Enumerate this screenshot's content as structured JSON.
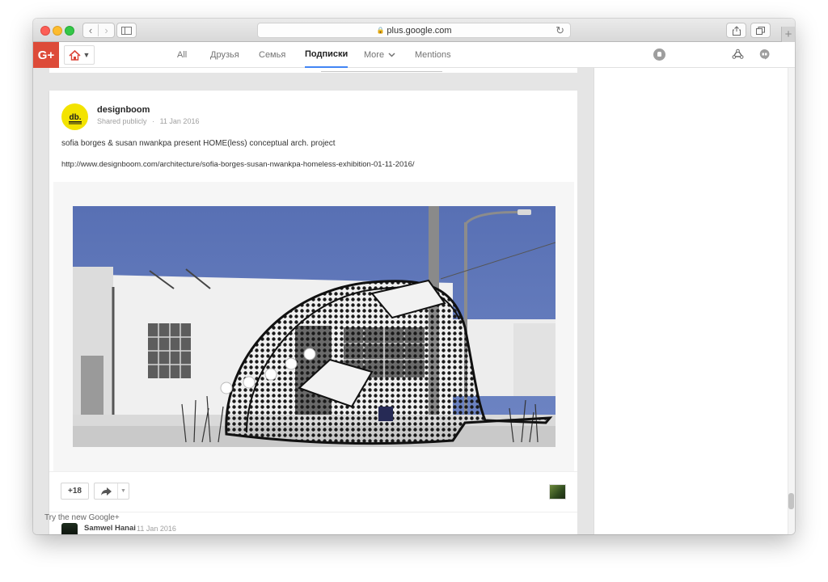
{
  "browser": {
    "url": "plus.google.com",
    "back_icon": "chevron-left-icon",
    "forward_icon": "chevron-right-icon",
    "sidebar_icon": "sidebar-icon",
    "lock_icon": "lock-icon",
    "reload_icon": "reload-icon",
    "share_icon": "share-icon",
    "tabs_icon": "tabs-overview-icon",
    "new_tab_label": "+"
  },
  "gplus_bar": {
    "logo": "G+",
    "home_icon": "home-icon",
    "nav": [
      {
        "label": "All",
        "active": false
      },
      {
        "label": "Друзья",
        "active": false
      },
      {
        "label": "Семья",
        "active": false
      },
      {
        "label": "Подписки",
        "active": true
      },
      {
        "label": "More",
        "active": false
      },
      {
        "label": "Mentions",
        "active": false
      }
    ],
    "more_chevron": "⌄",
    "notifications_icon": "notifications-icon",
    "share_icon": "share-nodes-icon",
    "hangouts_icon": "hangouts-icon",
    "colors": {
      "brand": "#dd4b39",
      "active_underline": "#4285f4"
    }
  },
  "post": {
    "author": "designboom",
    "avatar_text": "db.",
    "avatar_color": "#f3e300",
    "visibility": "Shared publicly",
    "separator": "·",
    "date": "11 Jan 2016",
    "text": "sofia borges & susan nwankpa present HOME(less) conceptual arch. project",
    "link": "http://www.designboom.com/architecture/sofia-borges-susan-nwankpa-homeless-exhibition-01-11-2016/",
    "image_subject": "photo of a white building with a dotted conceptual tent structure",
    "plus_count": "+18",
    "share_icon": "share-arrow-icon",
    "dropdown_icon": "caret-down-icon"
  },
  "comment": {
    "name": "Samwel Hanai",
    "time": "11 Jan 2016"
  },
  "footer": {
    "try_new": "Try the new Google+"
  }
}
